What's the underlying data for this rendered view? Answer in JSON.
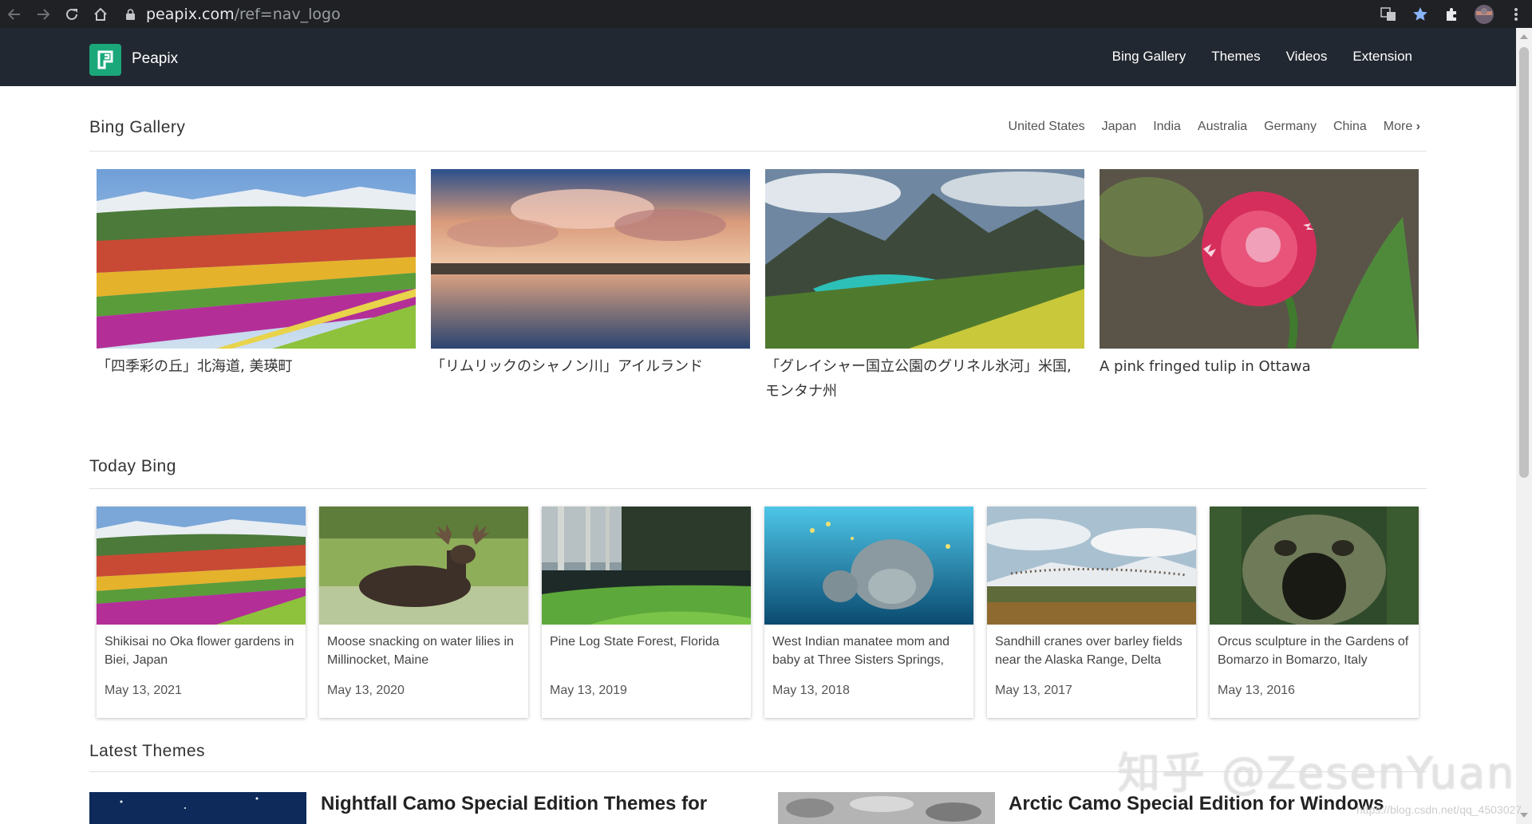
{
  "browser": {
    "url_host": "peapix.com",
    "url_path": "/ref=nav_logo"
  },
  "site": {
    "brand": "Peapix",
    "nav": [
      "Bing Gallery",
      "Themes",
      "Videos",
      "Extension"
    ]
  },
  "bing_gallery": {
    "title": "Bing Gallery",
    "countries": [
      "United States",
      "Japan",
      "India",
      "Australia",
      "Germany",
      "China",
      "More"
    ],
    "items": [
      {
        "caption": "「四季彩の丘」北海道, 美瑛町",
        "scene": "flowers"
      },
      {
        "caption": "「リムリックのシャノン川」アイルランド",
        "scene": "river"
      },
      {
        "caption": "「グレイシャー国立公園のグリネル氷河」米国, モンタナ州",
        "scene": "mountain"
      },
      {
        "caption": "A pink fringed tulip in Ottawa",
        "scene": "tulip"
      }
    ]
  },
  "today_bing": {
    "title": "Today Bing",
    "items": [
      {
        "desc": "Shikisai no Oka flower gardens in Biei, Japan",
        "date": "May 13, 2021",
        "scene": "flowers"
      },
      {
        "desc": "Moose snacking on water lilies in Millinocket, Maine",
        "date": "May 13, 2020",
        "scene": "moose"
      },
      {
        "desc": "Pine Log State Forest, Florida",
        "date": "May 13, 2019",
        "scene": "forest"
      },
      {
        "desc": "West Indian manatee mom and baby at Three Sisters Springs,",
        "date": "May 13, 2018",
        "scene": "manatee"
      },
      {
        "desc": "Sandhill cranes over barley fields near the Alaska Range, Delta",
        "date": "May 13, 2017",
        "scene": "cranes"
      },
      {
        "desc": "Orcus sculpture in the Gardens of Bomarzo in Bomarzo, Italy",
        "date": "May 13, 2016",
        "scene": "orcus"
      }
    ]
  },
  "latest_themes": {
    "title": "Latest Themes",
    "items": [
      {
        "title": "Nightfall Camo Special Edition Themes for",
        "scene": "night"
      },
      {
        "title": "Arctic Camo Special Edition for Windows",
        "scene": "camo"
      }
    ]
  },
  "watermark": {
    "main": "知乎 @ZesenYuan",
    "small": "https://blog.csdn.net/qq_4503027"
  }
}
